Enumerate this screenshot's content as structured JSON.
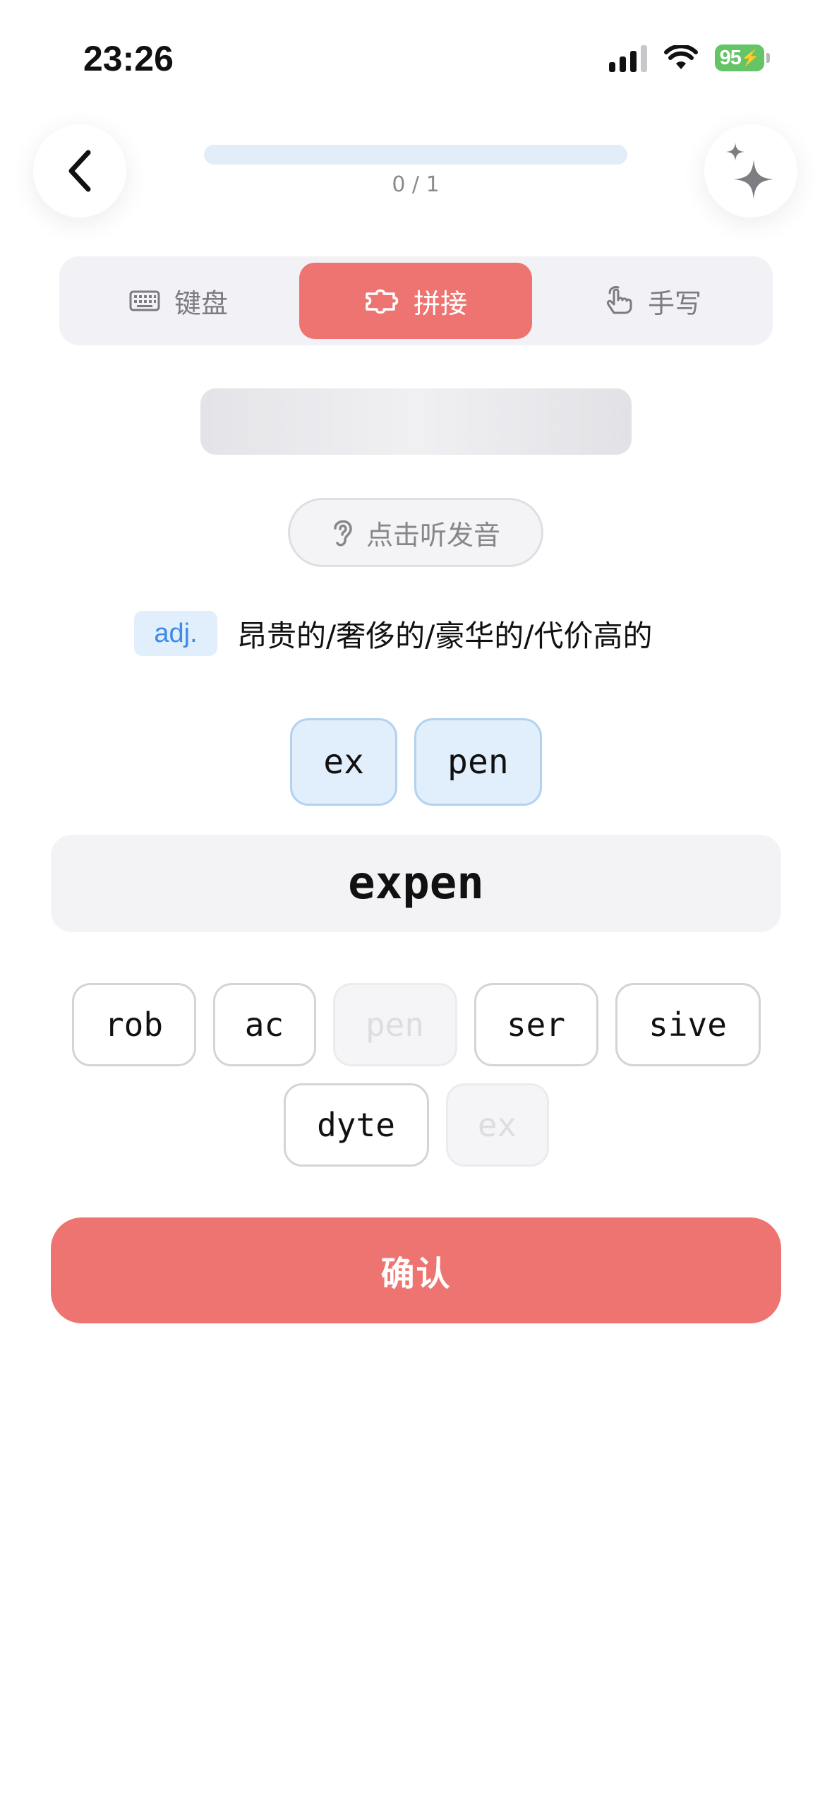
{
  "status": {
    "time": "23:26",
    "battery": "95"
  },
  "header": {
    "progress_text": "0 / 1",
    "progress_fraction": 0
  },
  "modes": {
    "keyboard": "键盘",
    "splice": "拼接",
    "handwrite": "手写",
    "selected": "splice"
  },
  "listen": {
    "label": "点击听发音"
  },
  "meaning": {
    "pos": "adj.",
    "definition": "昂贵的/奢侈的/豪华的/代价高的"
  },
  "chosen": [
    "ex",
    "pen"
  ],
  "answer": "expen",
  "pieces": {
    "row1": [
      {
        "text": "rob",
        "used": false
      },
      {
        "text": "ac",
        "used": false
      },
      {
        "text": "pen",
        "used": true
      },
      {
        "text": "ser",
        "used": false
      },
      {
        "text": "sive",
        "used": false
      }
    ],
    "row2": [
      {
        "text": "dyte",
        "used": false
      },
      {
        "text": "ex",
        "used": true
      }
    ]
  },
  "confirm": {
    "label": "确认"
  },
  "colors": {
    "accent": "#ee7471",
    "chip_blue_bg": "#e1eefb",
    "pos_blue": "#3d8be6",
    "battery_green": "#65c466"
  },
  "icons": {
    "back": "chevron-left-icon",
    "magic": "sparkles-icon",
    "keyboard": "keyboard-icon",
    "splice": "puzzle-icon",
    "handwrite": "hand-pointer-icon",
    "listen": "ear-icon"
  }
}
